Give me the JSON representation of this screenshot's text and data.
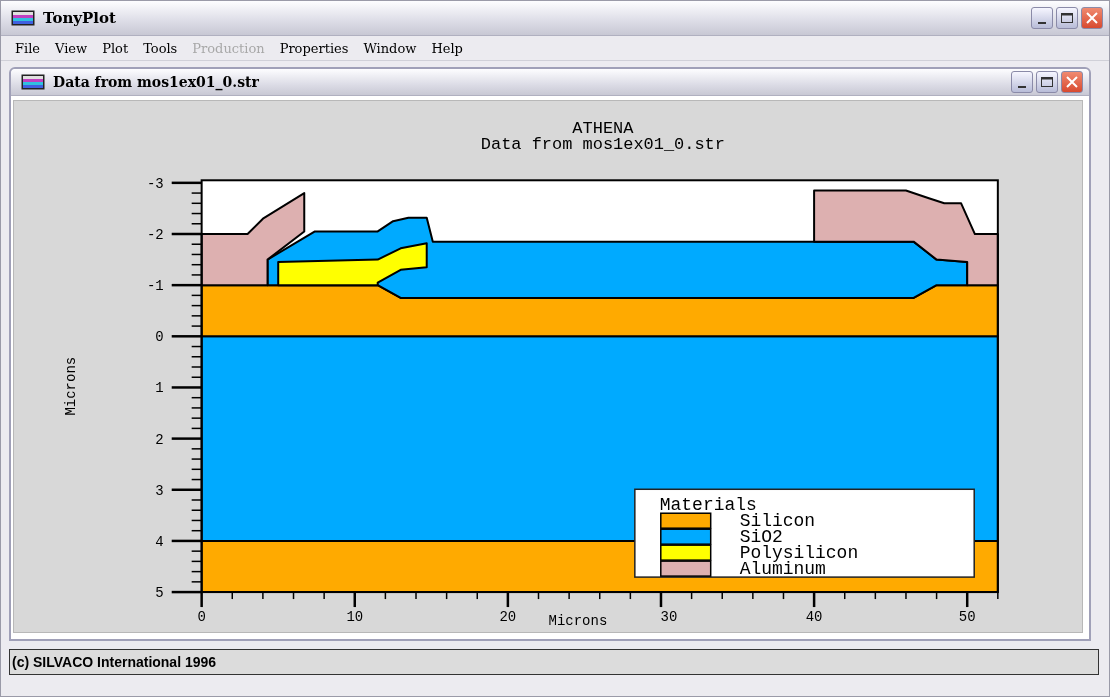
{
  "window": {
    "title": "TonyPlot"
  },
  "menu": [
    {
      "label": "File",
      "disabled": false
    },
    {
      "label": "View",
      "disabled": false
    },
    {
      "label": "Plot",
      "disabled": false
    },
    {
      "label": "Tools",
      "disabled": false
    },
    {
      "label": "Production",
      "disabled": true
    },
    {
      "label": "Properties",
      "disabled": false
    },
    {
      "label": "Window",
      "disabled": false
    },
    {
      "label": "Help",
      "disabled": false
    }
  ],
  "document": {
    "title": "Data from mos1ex01_0.str"
  },
  "plot": {
    "title": "ATHENA",
    "subtitle": "Data from mos1ex01_0.str",
    "xlabel": "Microns",
    "ylabel": "Microns",
    "xticks": [
      "0",
      "10",
      "20",
      "30",
      "40",
      "50"
    ],
    "yticks": [
      "-3",
      "-2",
      "-1",
      "0",
      "1",
      "2",
      "3",
      "4",
      "5"
    ],
    "legend": {
      "title": "Materials",
      "items": [
        {
          "label": "Silicon",
          "color": "#ffaa00"
        },
        {
          "label": "SiO2",
          "color": "#00aaff"
        },
        {
          "label": "Polysilicon",
          "color": "#ffff00"
        },
        {
          "label": "Aluminum",
          "color": "#ddb0b0"
        }
      ]
    }
  },
  "status_bar": "(c) SILVACO International 1996"
}
